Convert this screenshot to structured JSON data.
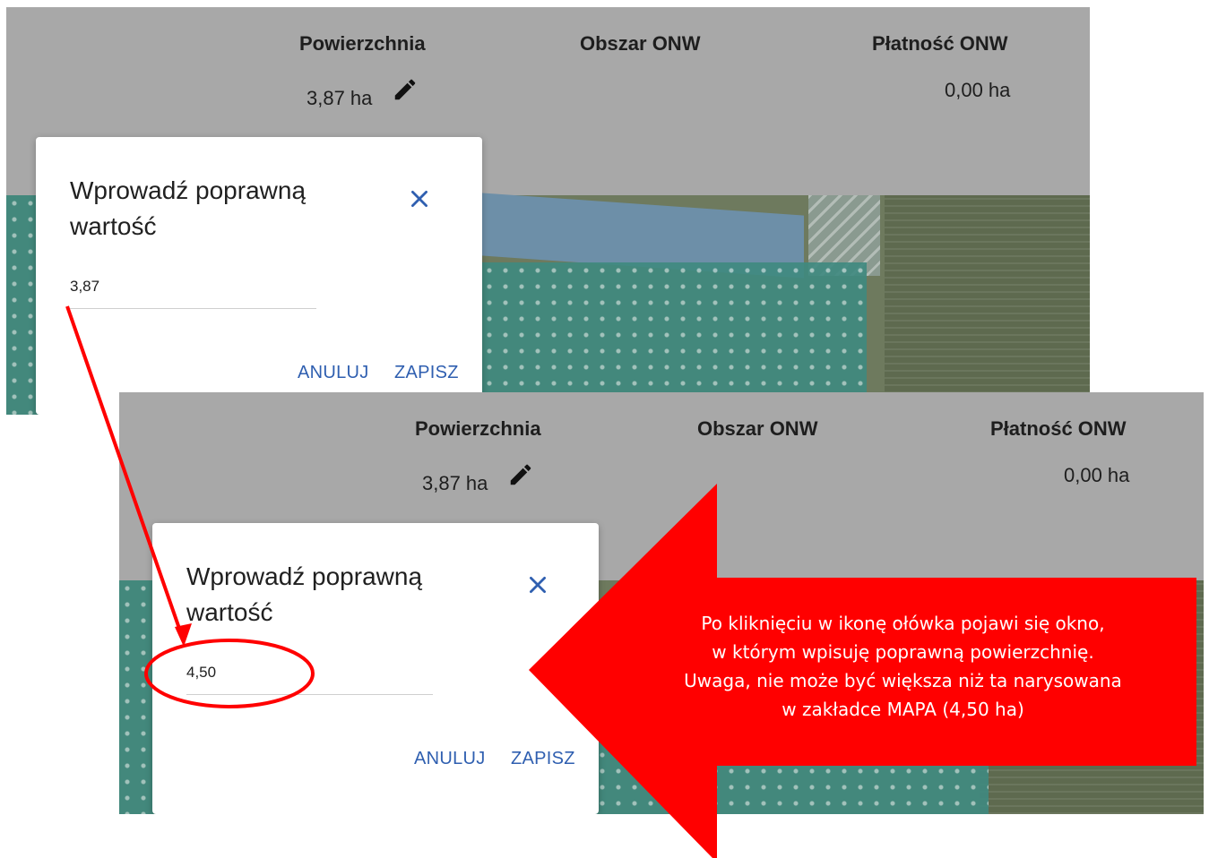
{
  "screenshot_top": {
    "columns": {
      "area": "Powierzchnia",
      "onw_area": "Obszar ONW",
      "onw_payment": "Płatność ONW"
    },
    "area_value": "3,87 ha",
    "payment_value": "0,00 ha",
    "dialog": {
      "title_line1": "Wprowadź poprawną",
      "title_line2": "wartość",
      "input_value": "3,87",
      "cancel_label": "ANULUJ",
      "save_label": "ZAPISZ"
    }
  },
  "screenshot_bottom": {
    "columns": {
      "area": "Powierzchnia",
      "onw_area": "Obszar ONW",
      "onw_payment": "Płatność ONW"
    },
    "area_value": "3,87 ha",
    "payment_value": "0,00 ha",
    "dialog": {
      "title_line1": "Wprowadź poprawną",
      "title_line2": "wartość",
      "input_value": "4,50",
      "cancel_label": "ANULUJ",
      "save_label": "ZAPISZ"
    }
  },
  "annotation": {
    "lines": [
      "Po kliknięciu w ikonę ołówka pojawi się okno,",
      "w którym wpisuję poprawną powierzchnię.",
      "Uwaga, nie może być większa niż ta narysowana",
      "w zakładce MAPA (4,50 ha)"
    ],
    "color": "#ff0000"
  },
  "icons": {
    "edit": "pencil-icon",
    "close": "close-icon"
  }
}
